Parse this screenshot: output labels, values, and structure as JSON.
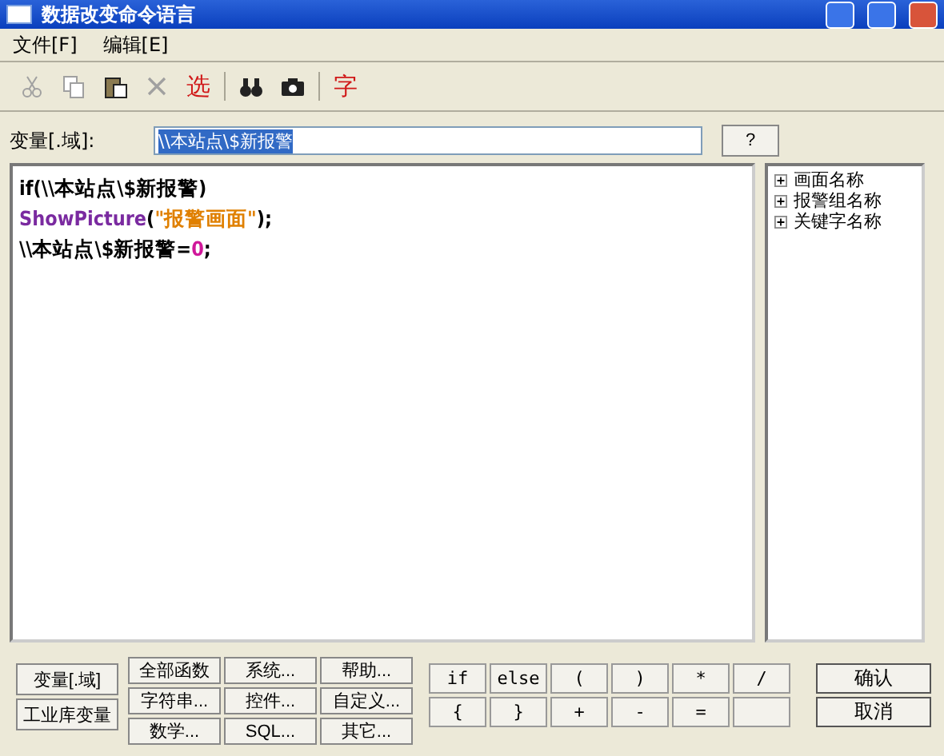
{
  "window": {
    "title": "数据改变命令语言"
  },
  "menu": [
    "文件[F]",
    "编辑[E]"
  ],
  "toolbar": [
    {
      "kind": "cut",
      "disabled": true
    },
    {
      "kind": "copy",
      "disabled": true
    },
    {
      "kind": "paste",
      "disabled": false
    },
    {
      "kind": "delete",
      "disabled": true
    },
    {
      "kind": "text",
      "label": "选",
      "disabled": false
    },
    {
      "kind": "sep"
    },
    {
      "kind": "find",
      "disabled": false
    },
    {
      "kind": "camera",
      "disabled": false
    },
    {
      "kind": "sep"
    },
    {
      "kind": "text",
      "label": "字",
      "disabled": false
    }
  ],
  "variable": {
    "label": "变量[.域]:",
    "value": "\\\\本站点\\$新报警",
    "help": "?"
  },
  "code": [
    [
      {
        "kind": "plain",
        "text": "if(\\\\本站点\\$新报警)"
      }
    ],
    [
      {
        "kind": "func",
        "text": "ShowPicture"
      },
      {
        "kind": "plain",
        "text": "("
      },
      {
        "kind": "string",
        "text": "\"报警画面\""
      },
      {
        "kind": "plain",
        "text": ");"
      }
    ],
    [
      {
        "kind": "plain",
        "text": "\\\\本站点\\$新报警="
      },
      {
        "kind": "number",
        "text": "0"
      },
      {
        "kind": "plain",
        "text": ";"
      }
    ]
  ],
  "tree": [
    {
      "label": "画面名称",
      "expanded": false
    },
    {
      "label": "报警组名称",
      "expanded": false
    },
    {
      "label": "关键字名称",
      "expanded": false
    }
  ],
  "left_buttons": [
    "变量[.域]",
    "工业库变量"
  ],
  "function_buttons": [
    "全部函数",
    "系统...",
    "帮助...",
    "字符串...",
    "控件...",
    "自定义...",
    "数学...",
    "SQL...",
    "其它..."
  ],
  "operator_buttons": [
    "if",
    "else",
    "(",
    ")",
    "*",
    "/",
    "{",
    "}",
    "+",
    "-",
    "="
  ],
  "dialog_buttons": [
    "确认",
    "取消"
  ]
}
